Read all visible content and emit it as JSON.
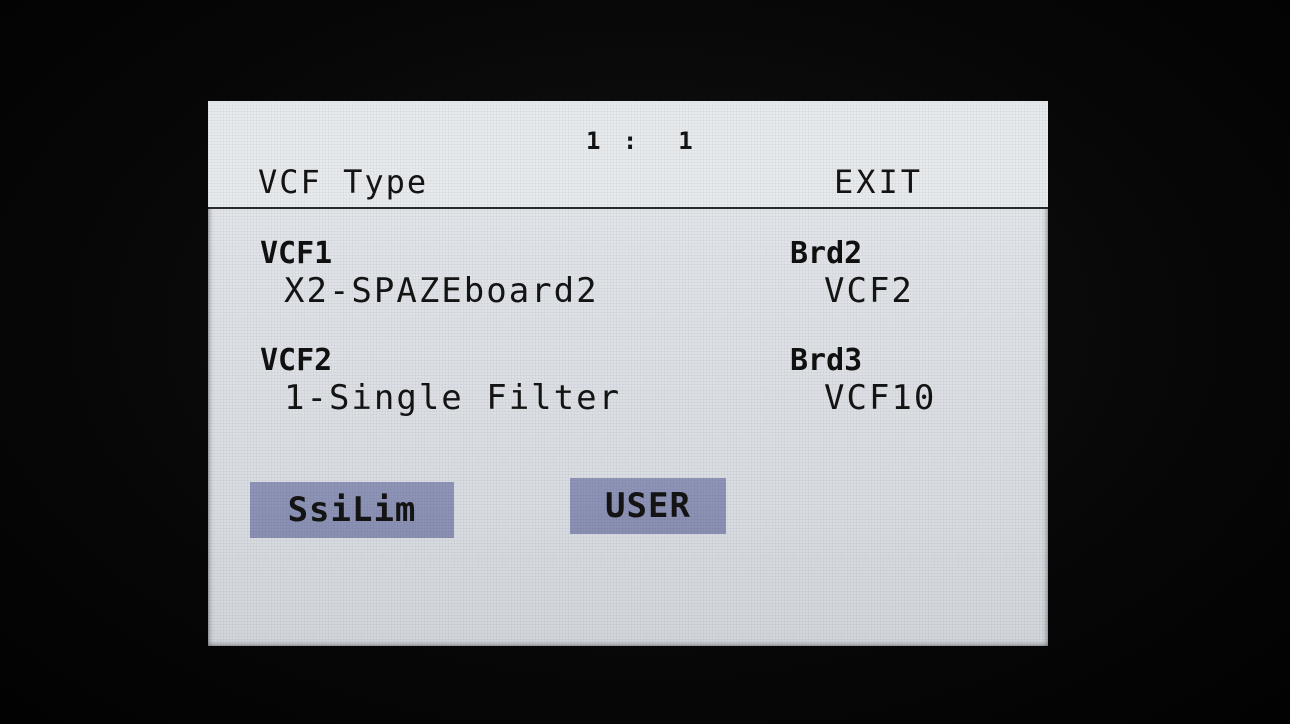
{
  "header": {
    "position": "1 :  1",
    "title": "VCF Type",
    "exit_label": "EXIT"
  },
  "params": [
    {
      "label": "VCF1",
      "value": "X2-SPAZEboard2"
    },
    {
      "label": "Brd2",
      "value": "VCF2"
    },
    {
      "label": "VCF2",
      "value": "1-Single Filter"
    },
    {
      "label": "Brd3",
      "value": "VCF10"
    }
  ],
  "buttons": {
    "ssilim_label": "SsiLim",
    "user_label": "USER"
  },
  "colors": {
    "screen_bg": "#dfe3e8",
    "button_bg": "#8a90b3",
    "text": "#141414"
  }
}
